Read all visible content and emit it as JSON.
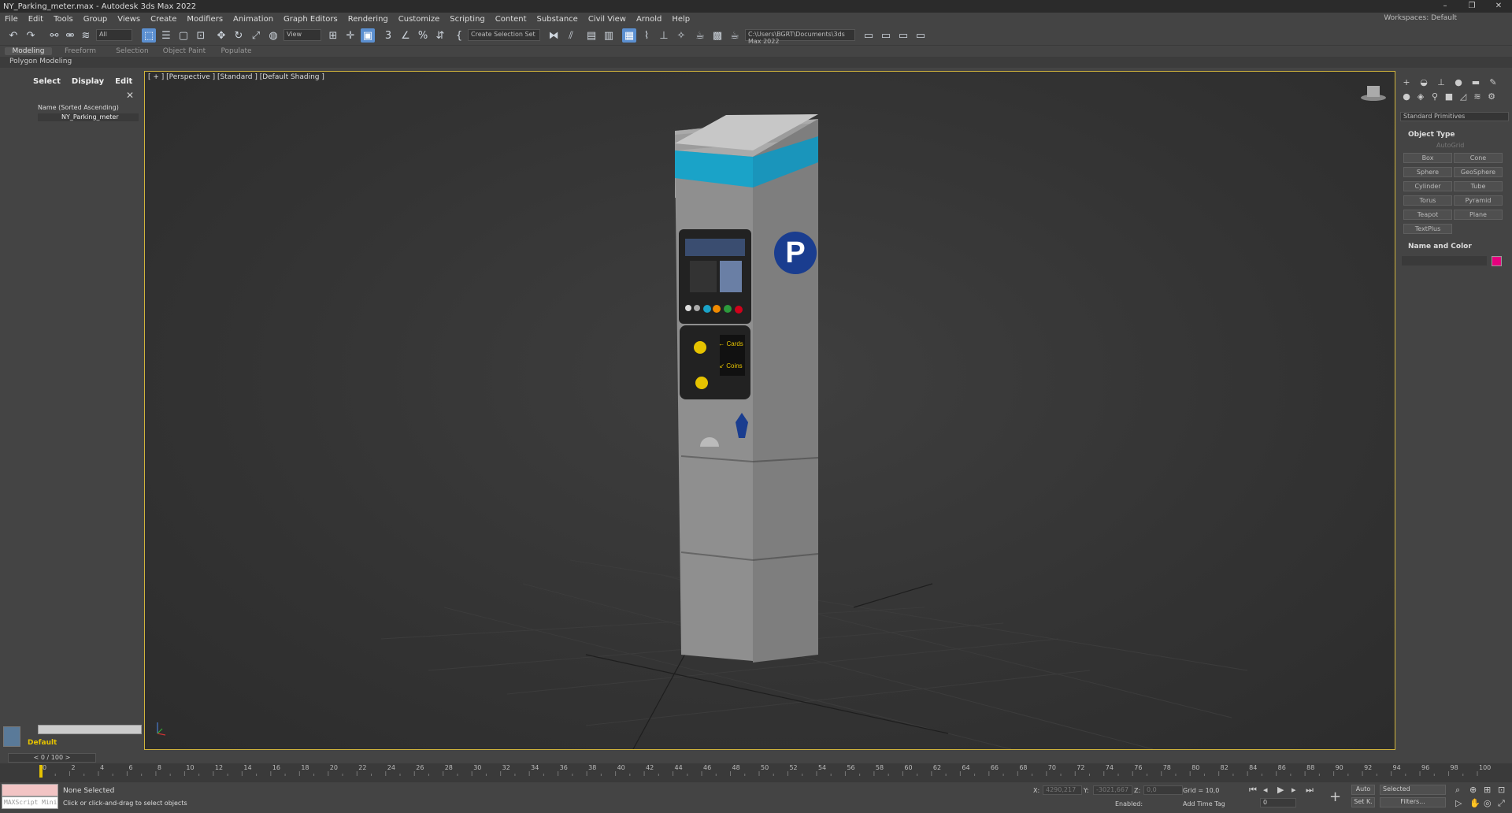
{
  "title_bar": {
    "title": "NY_Parking_meter.max - Autodesk 3ds Max 2022",
    "min": "–",
    "max": "❐",
    "close": "✕"
  },
  "menu": [
    "File",
    "Edit",
    "Tools",
    "Group",
    "Views",
    "Create",
    "Modifiers",
    "Animation",
    "Graph Editors",
    "Rendering",
    "Customize",
    "Scripting",
    "Content",
    "Substance",
    "Civil View",
    "Arnold",
    "Help"
  ],
  "workspaces": {
    "label": "Workspaces:",
    "value": "Default"
  },
  "toolbar": {
    "filter": "All",
    "ref_coord": "View",
    "selection_set": "Create Selection Set",
    "project_path": "C:\\Users\\BGRT\\Documents\\3ds Max 2022"
  },
  "ribbon": {
    "tabs": [
      "Modeling",
      "Freeform",
      "Selection",
      "Object Paint",
      "Populate"
    ],
    "active_tab": "Modeling",
    "sub": "Polygon Modeling"
  },
  "scene_explorer": {
    "tabs": [
      "Select",
      "Display",
      "Edit"
    ],
    "column_header": "Name (Sorted Ascending)",
    "items": [
      "NY_Parking_meter"
    ]
  },
  "layer": {
    "name": "Default"
  },
  "viewport": {
    "label": "[ + ] [Perspective ] [Standard ] [Default Shading ]",
    "meter_sign": "P",
    "meter_cards": "← Cards",
    "meter_coins": "↙ Coins"
  },
  "command_panel": {
    "category": "Standard Primitives",
    "rollout_object_type": "Object Type",
    "autogrid": "AutoGrid",
    "buttons": [
      "Box",
      "Cone",
      "Sphere",
      "GeoSphere",
      "Cylinder",
      "Tube",
      "Torus",
      "Pyramid",
      "Teapot",
      "Plane",
      "TextPlus"
    ],
    "rollout_name_color": "Name and Color",
    "object_color": "#e5007e"
  },
  "time": {
    "frame_slider": "0 / 100",
    "prev": "<",
    "next": ">",
    "ticks": [
      "0",
      "2",
      "4",
      "6",
      "8",
      "10",
      "12",
      "14",
      "16",
      "18",
      "20",
      "22",
      "24",
      "26",
      "28",
      "30",
      "32",
      "34",
      "36",
      "38",
      "40",
      "42",
      "44",
      "46",
      "48",
      "50",
      "52",
      "54",
      "56",
      "58",
      "60",
      "62",
      "64",
      "66",
      "68",
      "70",
      "72",
      "74",
      "76",
      "78",
      "80",
      "82",
      "84",
      "86",
      "88",
      "90",
      "92",
      "94",
      "96",
      "98",
      "100"
    ]
  },
  "status": {
    "selection": "None Selected",
    "prompt": "Click or click-and-drag to select objects",
    "maxscript": "MAXScript Mini",
    "x_label": "X:",
    "x_value": "4290,217",
    "y_label": "Y:",
    "y_value": "-3021,667",
    "z_label": "Z:",
    "z_value": "0,0",
    "grid": "Grid = 10,0",
    "enabled": "Enabled:",
    "add_time_tag": "Add Time Tag",
    "auto": "Auto",
    "set_key": "Set K.",
    "selected": "Selected",
    "filters": "Filters...",
    "frame": "0"
  }
}
